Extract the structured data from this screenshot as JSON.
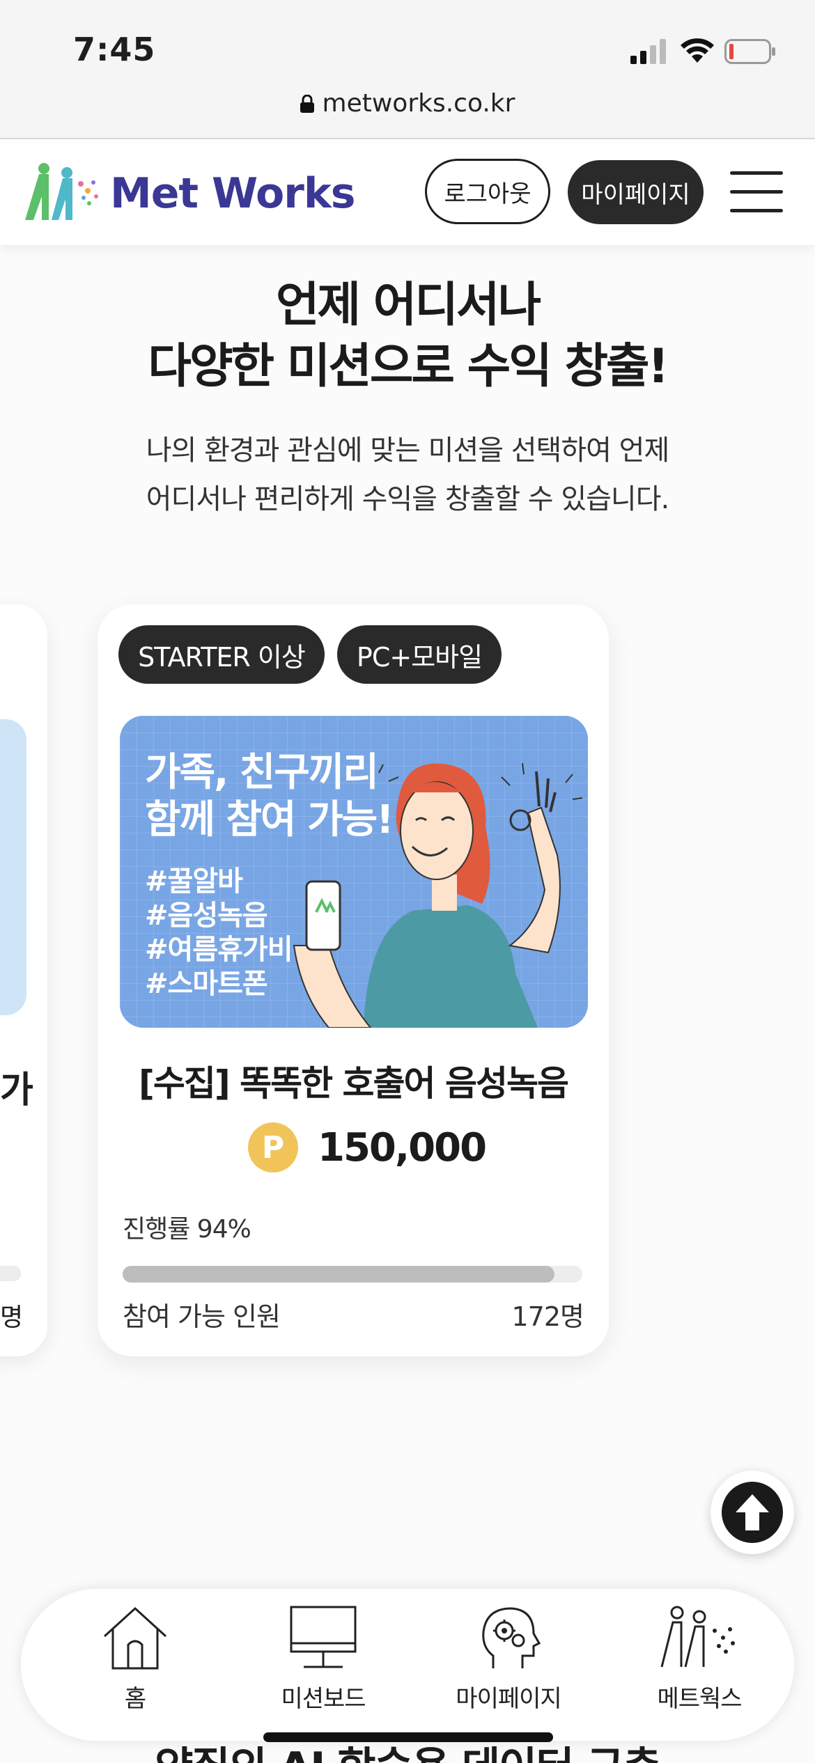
{
  "status_bar": {
    "time": "7:45"
  },
  "browser": {
    "url": "metworks.co.kr"
  },
  "header": {
    "logo_text": "Met Works",
    "logout_label": "로그아웃",
    "mypage_label": "마이페이지"
  },
  "hero": {
    "title_line1": "언제 어디서나",
    "title_line2": "다양한 미션으로 수익 창출!",
    "desc_line1": "나의 환경과 관심에 맞는 미션을 선택하여 언제",
    "desc_line2": "어디서나 편리하게 수익을 창출할 수 있습니다."
  },
  "side_card": {
    "title_fragment": "가",
    "subtitle_fragment": "명"
  },
  "mission_card": {
    "tags": [
      "STARTER 이상",
      "PC+모바일"
    ],
    "banner": {
      "title_line1": "가족, 친구끼리",
      "title_line2": "함께 참여 가능!",
      "hashtags": [
        "#꿀알바",
        "#음성녹음",
        "#여름휴가비",
        "#스마트폰"
      ]
    },
    "title": "[수집] 똑똑한 호출어 음성녹음",
    "point_symbol": "P",
    "points": "150,000",
    "progress_label": "진행률 94%",
    "progress_percent": 94,
    "available_label": "참여 가능 인원",
    "available_value": "172명"
  },
  "bottom_nav": {
    "items": [
      {
        "label": "홈",
        "icon": "home-icon"
      },
      {
        "label": "미션보드",
        "icon": "monitor-icon"
      },
      {
        "label": "마이페이지",
        "icon": "head-gears-icon"
      },
      {
        "label": "메트웍스",
        "icon": "metworks-logo-icon"
      }
    ]
  },
  "below_fold_text": "양질의 AI 학습용 데이터 구축",
  "colors": {
    "brand_text": "#3b3795",
    "point": "#f1c45a",
    "dark_button": "#2a2a2a",
    "banner_bg": "#7aa7e6"
  }
}
